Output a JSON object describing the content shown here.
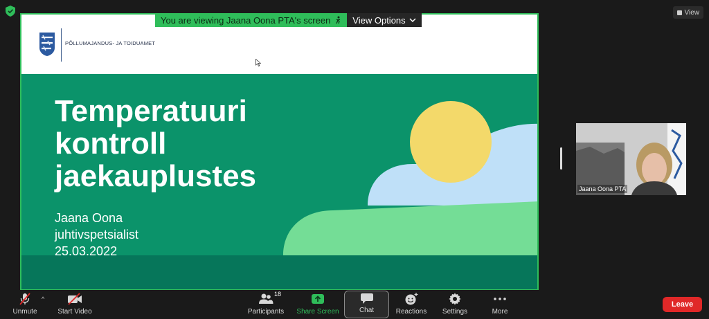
{
  "header": {
    "banner_message": "You are viewing Jaana Oona PTA's screen",
    "view_options_label": "View Options",
    "view_button_label": "View"
  },
  "slide": {
    "org_name": "Põllumajandus- ja Toiduamet",
    "title_lines": [
      "Temperatuuri",
      "kontroll",
      "jaekauplustes"
    ],
    "presenter_name": "Jaana Oona",
    "presenter_role": "juhtivspetsialist",
    "date": "25.03.2022"
  },
  "participant": {
    "name": "Jaana Oona PTA"
  },
  "toolbar": {
    "unmute_label": "Unmute",
    "start_video_label": "Start Video",
    "participants_label": "Participants",
    "participants_count": "18",
    "share_screen_label": "Share Screen",
    "chat_label": "Chat",
    "reactions_label": "Reactions",
    "settings_label": "Settings",
    "more_label": "More",
    "leave_label": "Leave"
  },
  "colors": {
    "accent_green": "#2fbd5a",
    "slide_green": "#0b936a",
    "slide_footer": "#06765a",
    "sun_yellow": "#f3d96a",
    "sky_blue": "#bfe0f8",
    "hill_green": "#74dd96",
    "leave_red": "#e02828"
  }
}
